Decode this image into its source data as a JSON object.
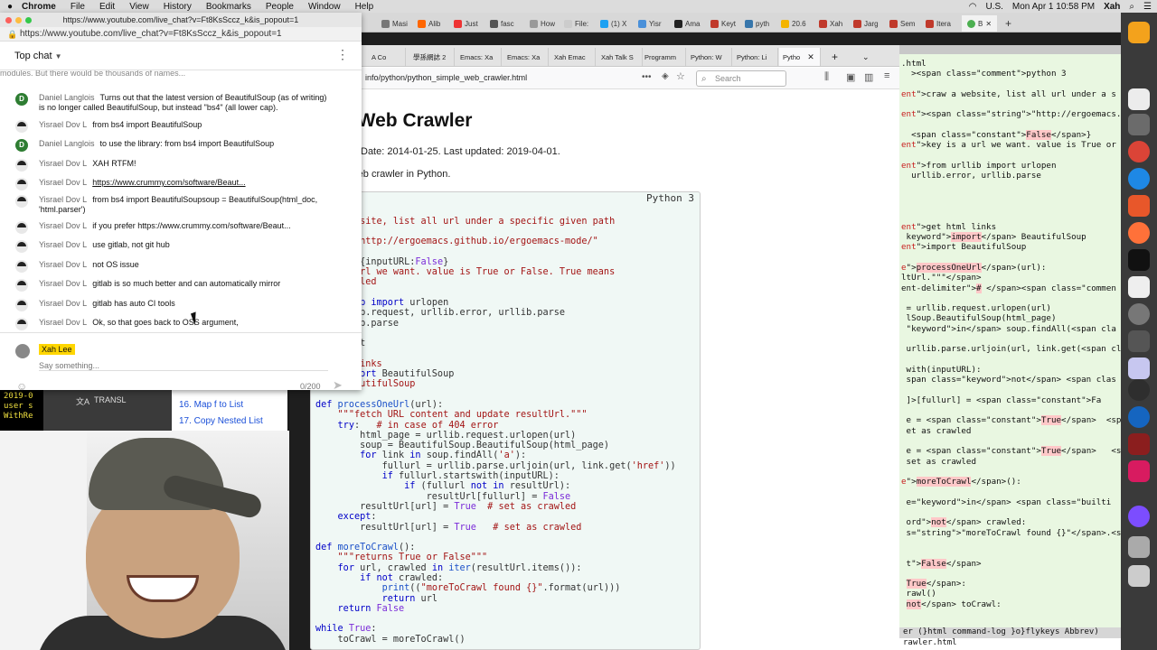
{
  "menubar": {
    "app": "Chrome",
    "items": [
      "File",
      "Edit",
      "View",
      "History",
      "Bookmarks",
      "People",
      "Window",
      "Help"
    ],
    "locale": "U.S.",
    "clock": "Mon Apr 1  10:58 PM",
    "user": "Xah"
  },
  "chrome_tabs": [
    "Masi",
    "Alib",
    "Just",
    "fasc",
    "How",
    "File:",
    "(1) X",
    "Yisr",
    "Ama",
    "Keyt",
    "pyth",
    "20.6",
    "Xah",
    "Jarg",
    "Sem",
    "Itera",
    "B"
  ],
  "chat_window": {
    "title": "https://www.youtube.com/live_chat?v=Ft8KsSccz_k&is_popout=1",
    "url": "https://www.youtube.com/live_chat?v=Ft8KsSccz_k&is_popout=1",
    "header": "Top chat",
    "cut_line": "modules. But there would be thousands of names...",
    "messages": [
      {
        "initial": "D",
        "author": "Daniel Langlois",
        "text": "Turns out that the latest version of BeautifulSoup (as of writing) is no longer called BeautifulSoup, but instead \"bs4\" (all lower cap)."
      },
      {
        "initial": "",
        "author": "Yisrael Dov L",
        "text": "from bs4 import BeautifulSoup"
      },
      {
        "initial": "D",
        "author": "Daniel Langlois",
        "text": "to use the library: from bs4 import BeautifulSoup"
      },
      {
        "initial": "",
        "author": "Yisrael Dov L",
        "text": "XAH RTFM!"
      },
      {
        "initial": "",
        "author": "Yisrael Dov L",
        "text": "https://www.crummy.com/software/Beaut..."
      },
      {
        "initial": "",
        "author": "Yisrael Dov L",
        "text": "from bs4 import BeautifulSoupsoup = BeautifulSoup(html_doc, 'html.parser')"
      },
      {
        "initial": "",
        "author": "Yisrael Dov L",
        "text": "if you prefer https://www.crummy.com/software/Beaut..."
      },
      {
        "initial": "",
        "author": "Yisrael Dov L",
        "text": "use gitlab, not git hub"
      },
      {
        "initial": "",
        "author": "Yisrael Dov L",
        "text": "not OS issue"
      },
      {
        "initial": "",
        "author": "Yisrael Dov L",
        "text": "gitlab is so much better and can automatically mirror"
      },
      {
        "initial": "",
        "author": "Yisrael Dov L",
        "text": "gitlab has auto CI tools"
      },
      {
        "initial": "",
        "author": "Yisrael Dov L",
        "text": "Ok, so that goes back to OSS argument,"
      }
    ],
    "me": "Xah Lee",
    "input_placeholder": "Say something...",
    "char_count": "0/200"
  },
  "firefox": {
    "tabs": [
      "A Co",
      "學孫網誌 2",
      "Emacs: Xa",
      "Emacs: Xa",
      "Xah Emac",
      "Xah Talk S",
      "Programm",
      "Python: W",
      "Python: Li",
      "Pytho"
    ],
    "url": "info/python/python_simple_web_crawler.html",
    "search_placeholder": "Search",
    "page_title": "n: Web Crawler",
    "date_line": "Date: 2014-01-25. Last updated: 2019-04-01.",
    "desc": "ple web crawler in Python.",
    "code_lang": "Python 3"
  },
  "lower_left": {
    "terminal": [
      "2019-0",
      "user s",
      "WithRe"
    ],
    "translate": "TRANSL",
    "list": [
      "16. Map f to List",
      "17. Copy Nested List"
    ]
  },
  "emacs": {
    "mode_line": "er  (}html command-log }o}flykeys Abbrev)",
    "echo": "rawler.html"
  }
}
